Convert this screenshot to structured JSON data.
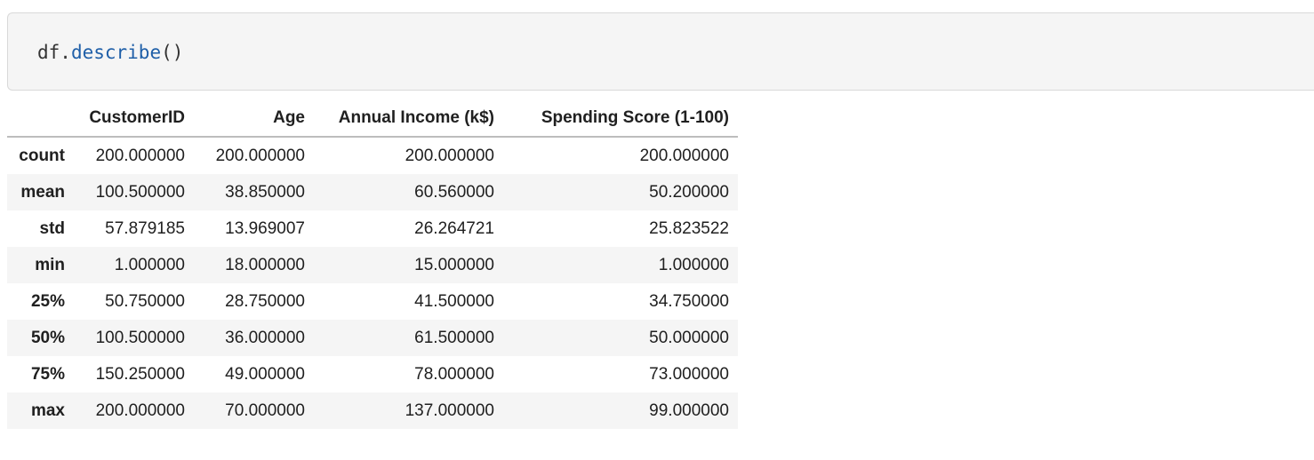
{
  "code_cell": {
    "prefix": "df.",
    "function": "describe",
    "suffix": "()"
  },
  "table": {
    "index_header": "",
    "columns": [
      "CustomerID",
      "Age",
      "Annual Income (k$)",
      "Spending Score (1-100)"
    ],
    "rows": [
      {
        "label": "count",
        "values": [
          "200.000000",
          "200.000000",
          "200.000000",
          "200.000000"
        ]
      },
      {
        "label": "mean",
        "values": [
          "100.500000",
          "38.850000",
          "60.560000",
          "50.200000"
        ]
      },
      {
        "label": "std",
        "values": [
          "57.879185",
          "13.969007",
          "26.264721",
          "25.823522"
        ]
      },
      {
        "label": "min",
        "values": [
          "1.000000",
          "18.000000",
          "15.000000",
          "1.000000"
        ]
      },
      {
        "label": "25%",
        "values": [
          "50.750000",
          "28.750000",
          "41.500000",
          "34.750000"
        ]
      },
      {
        "label": "50%",
        "values": [
          "100.500000",
          "36.000000",
          "61.500000",
          "50.000000"
        ]
      },
      {
        "label": "75%",
        "values": [
          "150.250000",
          "49.000000",
          "78.000000",
          "73.000000"
        ]
      },
      {
        "label": "max",
        "values": [
          "200.000000",
          "70.000000",
          "137.000000",
          "99.000000"
        ]
      }
    ]
  }
}
